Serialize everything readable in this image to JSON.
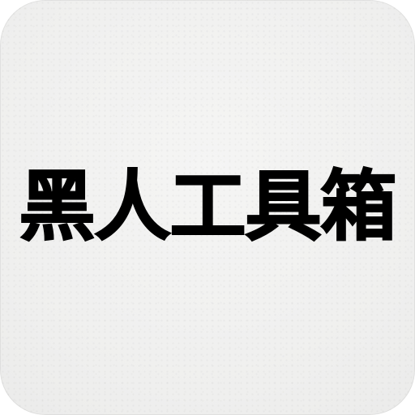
{
  "app_icon": {
    "title": "黑人工具箱",
    "background_color": "#f1f1f0",
    "text_color": "#000000"
  }
}
